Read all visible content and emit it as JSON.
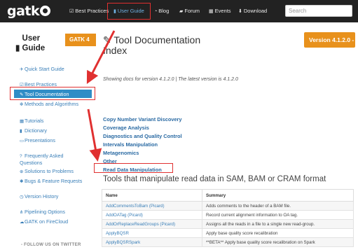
{
  "navbar": {
    "logo": "gatk",
    "items": [
      {
        "label": "Best Practices",
        "icon": "checkbox-icon"
      },
      {
        "label": "User Guide",
        "icon": "book-icon"
      },
      {
        "label": "Blog",
        "icon": "rss-icon"
      },
      {
        "label": "Forum",
        "icon": "comments-icon"
      },
      {
        "label": "Events",
        "icon": "calendar-icon"
      },
      {
        "label": "Download",
        "icon": "download-icon"
      }
    ],
    "active_item": "User Guide",
    "search_placeholder": "Search"
  },
  "sidebar": {
    "title": "User Guide",
    "gatk_badge": "GATK 4",
    "items": [
      {
        "label": "Quick Start Guide",
        "icon": "plane-icon"
      },
      {
        "label": "Best Practices",
        "icon": "checkbox-icon"
      },
      {
        "label": "Tool Documentation",
        "icon": "wrench-icon"
      },
      {
        "label": "Methods and Algorithms",
        "icon": "gear-icon"
      },
      {
        "label": "Tutorials",
        "icon": "grid-icon"
      },
      {
        "label": "Dictionary",
        "icon": "book-icon"
      },
      {
        "label": "Presentations",
        "icon": "slides-icon"
      },
      {
        "label": "Frequently Asked Questions",
        "icon": "question-icon"
      },
      {
        "label": "Solutions to Problems",
        "icon": "lifebuoy-icon"
      },
      {
        "label": "Bugs & Feature Requests",
        "icon": "bug-icon"
      },
      {
        "label": "Version History",
        "icon": "history-icon"
      },
      {
        "label": "Pipelining Options",
        "icon": "flowchart-icon"
      },
      {
        "label": "GATK on FireCloud",
        "icon": "cloud-icon"
      }
    ],
    "active_item": "Tool Documentation",
    "follow_label": "- FOLLOW US ON TWITTER"
  },
  "main": {
    "title": "Tool Documentation Index",
    "version_button": "Version 4.1.2.0 -",
    "showing_text": "Showing docs for version 4.1.2.0 | The latest version is 4.1.2.0",
    "categories": [
      "Copy Number Variant Discovery",
      "Coverage Analysis",
      "Diagnostics and Quality Control",
      "Intervals Manipulation",
      "Metagenomics",
      "Other",
      "Read Data Manipulation"
    ],
    "section_title": "Tools that manipulate read data in SAM, BAM or CRAM format",
    "table": {
      "headers": [
        "Name",
        "Summary"
      ],
      "rows": [
        [
          "AddCommentsToBam (Picard)",
          "Adds comments to the header of a BAM file."
        ],
        [
          "AddOATag (Picard)",
          "Record current alignment information to OA tag."
        ],
        [
          "AddOrReplaceReadGroups (Picard)",
          "Assigns all the reads in a file to a single new read-group."
        ],
        [
          "ApplyBQSR",
          "Apply base quality score recalibration"
        ],
        [
          "ApplyBQSRSpark",
          "**BETA** Apply base quality score recalibration on Spark"
        ]
      ]
    }
  },
  "annotation_color": "#e03030",
  "accent_color": "#2f8dc6",
  "orange_color": "#e8911c"
}
